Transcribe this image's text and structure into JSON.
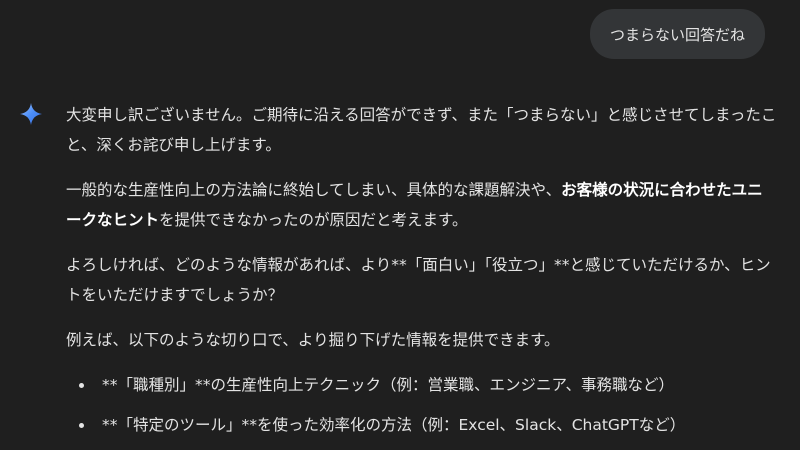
{
  "user_message": "つまらない回答だね",
  "response": {
    "p1": "大変申し訳ございません。ご期待に沿える回答ができず、また「つまらない」と感じさせてしまったこと、深くお詫び申し上げます。",
    "p2_before": "一般的な生産性向上の方法論に終始してしまい、具体的な課題解決や、",
    "p2_bold": "お客様の状況に合わせたユニークなヒント",
    "p2_after": "を提供できなかったのが原因だと考えます。",
    "p3": "よろしければ、どのような情報があれば、より**「面白い」「役立つ」**と感じていただけるか、ヒントをいただけますでしょうか？",
    "p4": "例えば、以下のような切り口で、より掘り下げた情報を提供できます。",
    "bullets": [
      "**「職種別」**の生産性向上テクニック（例：営業職、エンジニア、事務職など）",
      "**「特定のツール」**を使った効率化の方法（例：Excel、Slack、ChatGPTなど）"
    ]
  },
  "icons": {
    "assistant": "gemini-spark-icon"
  },
  "colors": {
    "background": "#1f1f1f",
    "user_bubble": "#333537",
    "text": "#e3e3e3",
    "spark_blue": "#4b8df8"
  }
}
